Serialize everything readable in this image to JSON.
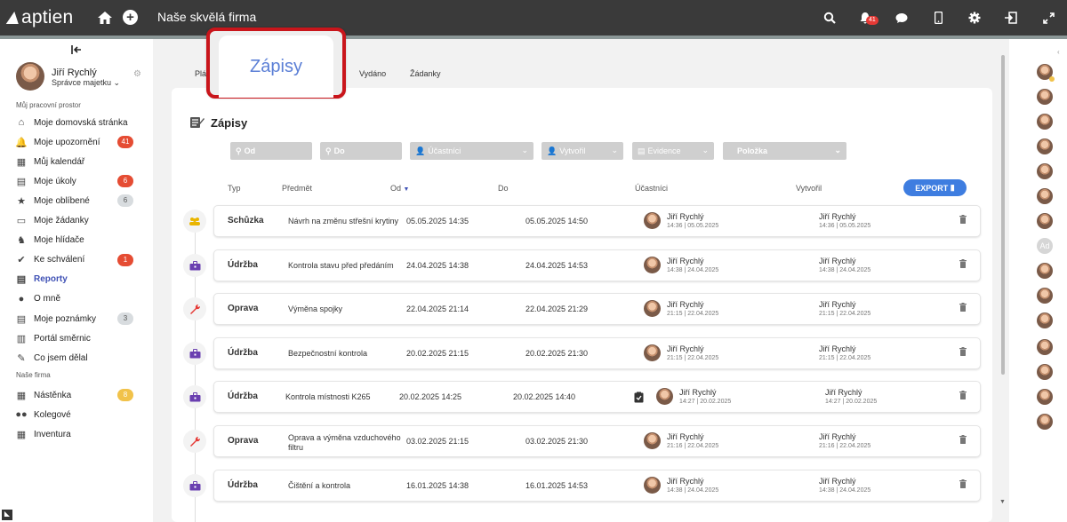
{
  "app": {
    "logo": "aptien",
    "company": "Naše skvělá firma",
    "notifications_count": "41"
  },
  "user": {
    "name": "Jiří Rychlý",
    "role": "Správce majetku"
  },
  "sidebar": {
    "section1": "Můj pracovní prostor",
    "items": [
      {
        "label": "Moje domovská stránka",
        "icon": "home-icon"
      },
      {
        "label": "Moje upozornění",
        "icon": "bell-icon",
        "badge": "41",
        "badge_color": "red"
      },
      {
        "label": "Můj kalendář",
        "icon": "calendar-icon"
      },
      {
        "label": "Moje úkoly",
        "icon": "task-icon",
        "badge": "6",
        "badge_color": "red"
      },
      {
        "label": "Moje oblíbené",
        "icon": "star-icon",
        "badge": "6",
        "badge_color": "grey"
      },
      {
        "label": "Moje žádanky",
        "icon": "document-icon"
      },
      {
        "label": "Moje hlídače",
        "icon": "dog-icon"
      },
      {
        "label": "Ke schválení",
        "icon": "check-circle-icon",
        "badge": "1",
        "badge_color": "red"
      },
      {
        "label": "Reporty",
        "icon": "report-icon",
        "active": true
      },
      {
        "label": "O mně",
        "icon": "person-icon"
      },
      {
        "label": "Moje poznámky",
        "icon": "note-icon",
        "badge": "3",
        "badge_color": "grey"
      },
      {
        "label": "Portál směrnic",
        "icon": "portal-icon"
      },
      {
        "label": "Co jsem dělal",
        "icon": "history-icon"
      }
    ],
    "section2": "Naše firma",
    "items2": [
      {
        "label": "Nástěnka",
        "icon": "board-icon",
        "badge": "8",
        "badge_color": "yellow"
      },
      {
        "label": "Kolegové",
        "icon": "people-icon"
      },
      {
        "label": "Inventura",
        "icon": "inventory-icon"
      }
    ]
  },
  "tabs": [
    {
      "label": "Plá"
    },
    {
      "label": "Vydáno"
    },
    {
      "label": "Žádanky"
    }
  ],
  "highlight_tab": "Zápisy",
  "panel": {
    "title": "Zápisy"
  },
  "filters": [
    {
      "label": "Od",
      "icon": "search-icon"
    },
    {
      "label": "Do",
      "icon": "search-icon"
    },
    {
      "label": "Účastníci",
      "icon": "person-icon"
    },
    {
      "label": "Vytvořil",
      "icon": "person-icon"
    },
    {
      "label": "Evidence",
      "icon": "list-icon"
    },
    {
      "label": "Položka"
    }
  ],
  "columns": {
    "typ": "Typ",
    "predmet": "Předmět",
    "od": "Od",
    "do": "Do",
    "ucastnici": "Účastníci",
    "vytvoril": "Vytvořil"
  },
  "export_label": "EXPORT",
  "rows": [
    {
      "typ": "Schůzka",
      "predmet": "Návrh na změnu střešní krytiny",
      "od": "05.05.2025 14:35",
      "do": "05.05.2025 14:50",
      "u_name": "Jiří Rychlý",
      "u_time": "14:36 | 05.05.2025",
      "v_name": "Jiří Rychlý",
      "v_time": "14:36 | 05.05.2025",
      "icon": "meeting-icon",
      "color": "#e9b500"
    },
    {
      "typ": "Údržba",
      "predmet": "Kontrola stavu před předáním",
      "od": "24.04.2025 14:38",
      "do": "24.04.2025 14:53",
      "u_name": "Jiří Rychlý",
      "u_time": "14:38 | 24.04.2025",
      "v_name": "Jiří Rychlý",
      "v_time": "14:38 | 24.04.2025",
      "icon": "toolbox-icon",
      "color": "#6a3fb0"
    },
    {
      "typ": "Oprava",
      "predmet": "Výměna spojky",
      "od": "22.04.2025 21:14",
      "do": "22.04.2025 21:29",
      "u_name": "Jiří Rychlý",
      "u_time": "21:15 | 22.04.2025",
      "v_name": "Jiří Rychlý",
      "v_time": "21:15 | 22.04.2025",
      "icon": "wrench-icon",
      "color": "#e53935"
    },
    {
      "typ": "Údržba",
      "predmet": "Bezpečnostní kontrola",
      "od": "20.02.2025 21:15",
      "do": "20.02.2025 21:30",
      "u_name": "Jiří Rychlý",
      "u_time": "21:15 | 22.04.2025",
      "v_name": "Jiří Rychlý",
      "v_time": "21:15 | 22.04.2025",
      "icon": "toolbox-icon",
      "color": "#6a3fb0"
    },
    {
      "typ": "Údržba",
      "predmet": "Kontrola místnosti K265",
      "od": "20.02.2025 14:25",
      "do": "20.02.2025 14:40",
      "u_name": "Jiří Rychlý",
      "u_time": "14:27 | 20.02.2025",
      "v_name": "Jiří Rychlý",
      "v_time": "14:27 | 20.02.2025",
      "icon": "toolbox-icon",
      "color": "#6a3fb0",
      "clipboard": true
    },
    {
      "typ": "Oprava",
      "predmet": "Oprava a výměna vzduchového",
      "predmet2": "filtru",
      "od": "03.02.2025 21:15",
      "do": "03.02.2025 21:30",
      "u_name": "Jiří Rychlý",
      "u_time": "21:16 | 22.04.2025",
      "v_name": "Jiří Rychlý",
      "v_time": "21:16 | 22.04.2025",
      "icon": "wrench-icon",
      "color": "#e53935"
    },
    {
      "typ": "Údržba",
      "predmet": "Čištění a kontrola",
      "od": "16.01.2025 14:38",
      "do": "16.01.2025 14:53",
      "u_name": "Jiří Rychlý",
      "u_time": "14:38 | 24.04.2025",
      "v_name": "Jiří Rychlý",
      "v_time": "14:38 | 24.04.2025",
      "icon": "toolbox-icon",
      "color": "#6a3fb0"
    }
  ],
  "right_avatar_text": "Ad"
}
